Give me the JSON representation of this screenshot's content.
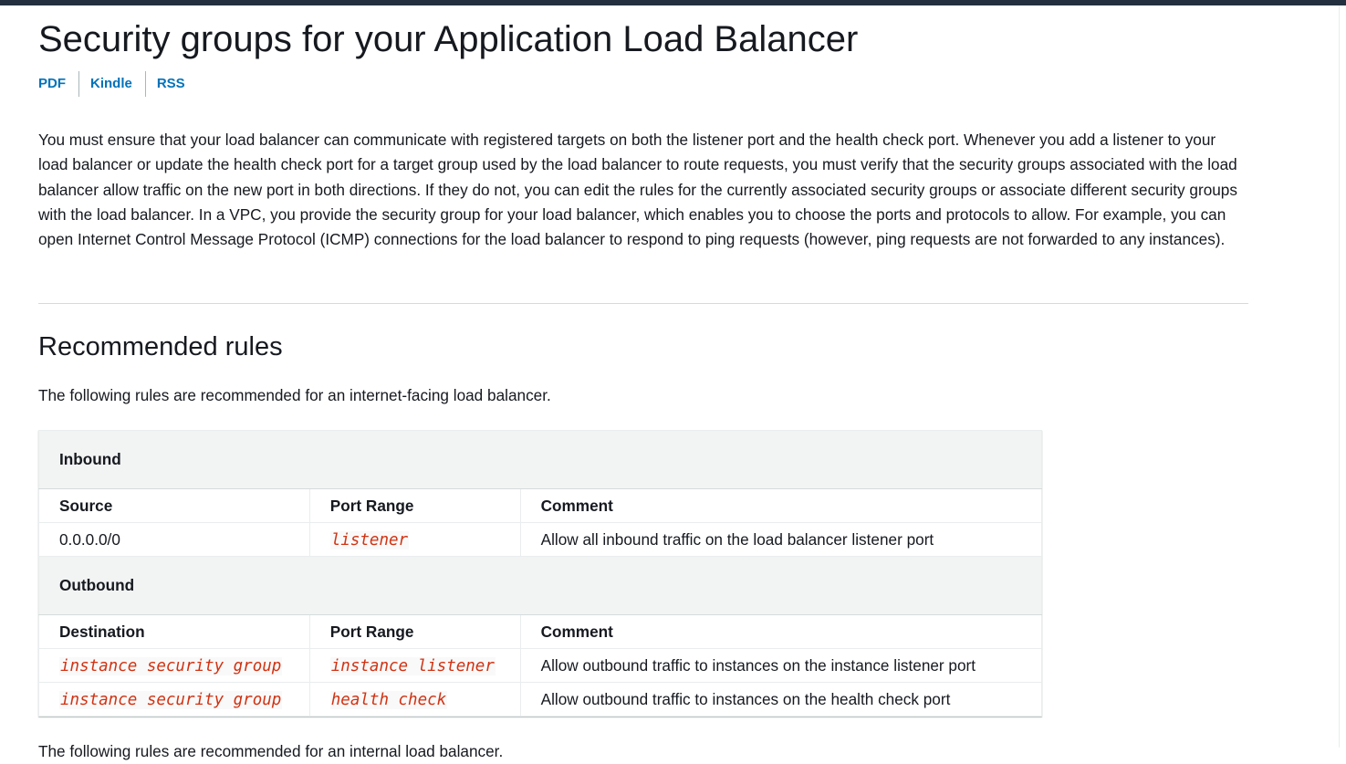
{
  "page": {
    "title": "Security groups for your Application Load Balancer",
    "links": [
      "PDF",
      "Kindle",
      "RSS"
    ],
    "intro": "You must ensure that your load balancer can communicate with registered targets on both the listener port and the health check port. Whenever you add a listener to your load balancer or update the health check port for a target group used by the load balancer to route requests, you must verify that the security groups associated with the load balancer allow traffic on the new port in both directions. If they do not, you can edit the rules for the currently associated security groups or associate different security groups with the load balancer. In a VPC, you provide the security group for your load balancer, which enables you to choose the ports and protocols to allow. For example, you can open Internet Control Message Protocol (ICMP) connections for the load balancer to respond to ping requests (however, ping requests are not forwarded to any instances).",
    "section_title": "Recommended rules",
    "section_intro": "The following rules are recommended for an internet-facing load balancer.",
    "trailing_text": "The following rules are recommended for an internal load balancer."
  },
  "table": {
    "inbound": {
      "label": "Inbound",
      "headers": [
        "Source",
        "Port Range",
        "Comment"
      ],
      "rows": [
        {
          "source": "0.0.0.0/0",
          "port": "listener",
          "comment": "Allow all inbound traffic on the load balancer listener port"
        }
      ]
    },
    "outbound": {
      "label": "Outbound",
      "headers": [
        "Destination",
        "Port Range",
        "Comment"
      ],
      "rows": [
        {
          "destination": "instance security group",
          "port": "instance listener",
          "comment": "Allow outbound traffic to instances on the instance listener port"
        },
        {
          "destination": "instance security group",
          "port": "health check",
          "comment": "Allow outbound traffic to instances on the health check port"
        }
      ]
    }
  },
  "colors": {
    "link": "#0073bb",
    "code": "#d13212",
    "topbar": "#232f3e"
  }
}
